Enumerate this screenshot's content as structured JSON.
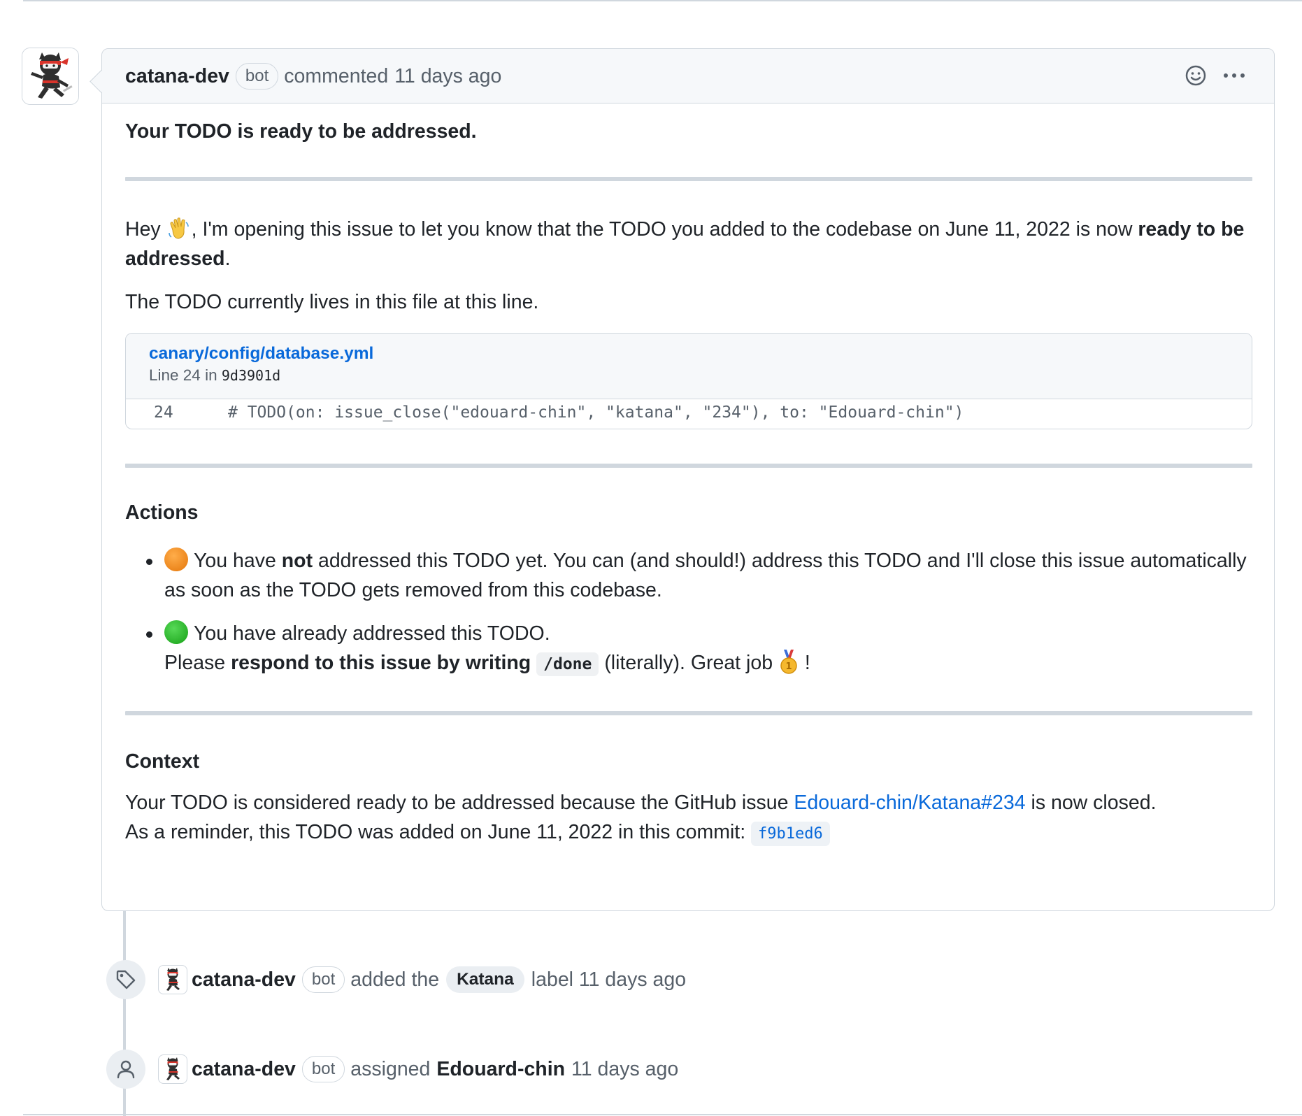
{
  "comment": {
    "author": "catana-dev",
    "badge": "bot",
    "action": "commented",
    "time": "11 days ago",
    "title": "Your TODO is ready to be addressed.",
    "intro": {
      "hey": "Hey",
      "emoji": "waving-hand",
      "text": ", I'm opening this issue to let you know that the TODO you added to the codebase on June 11, 2022 is now",
      "bold": "ready to be addressed",
      "end": "."
    },
    "lives_text": "The TODO currently lives in this file at this line.",
    "snippet": {
      "file": "canary/config/database.yml",
      "line_prefix": "Line 24 in",
      "commit": "9d3901d",
      "line_number": "24",
      "code": "# TODO(on: issue_close(\"edouard-chin\", \"katana\", \"234\"), to: \"Edouard-chin\")"
    },
    "actions": {
      "heading": "Actions",
      "item1": {
        "pre": "You have",
        "bold": "not",
        "post": "addressed this TODO yet. You can (and should!) address this TODO and I'll close this issue automatically as soon as the TODO gets removed from this codebase."
      },
      "item2": {
        "line1": "You have already addressed this TODO.",
        "pre": "Please",
        "bold": "respond to this issue by writing",
        "code": "/done",
        "post": "(literally). Great job",
        "end": "!"
      }
    },
    "context": {
      "heading": "Context",
      "line1_pre": "Your TODO is considered ready to be addressed because the GitHub issue",
      "line1_link": "Edouard-chin/Katana#234",
      "line1_post": "is now closed.",
      "line2_pre": "As a reminder, this TODO was added on June 11, 2022 in this commit:",
      "line2_sha": "f9b1ed6"
    }
  },
  "events": [
    {
      "icon": "tag-icon",
      "author": "catana-dev",
      "badge": "bot",
      "pre": "added the",
      "label": "Katana",
      "post": "label 11 days ago"
    },
    {
      "icon": "person-icon",
      "author": "catana-dev",
      "badge": "bot",
      "pre": "assigned",
      "assignee": "Edouard-chin",
      "post": "11 days ago"
    }
  ],
  "colors": {
    "link": "#0969da",
    "border": "#d0d7de",
    "header_bg": "#f6f8fa",
    "text": "#1f2328",
    "muted": "#57606a"
  }
}
